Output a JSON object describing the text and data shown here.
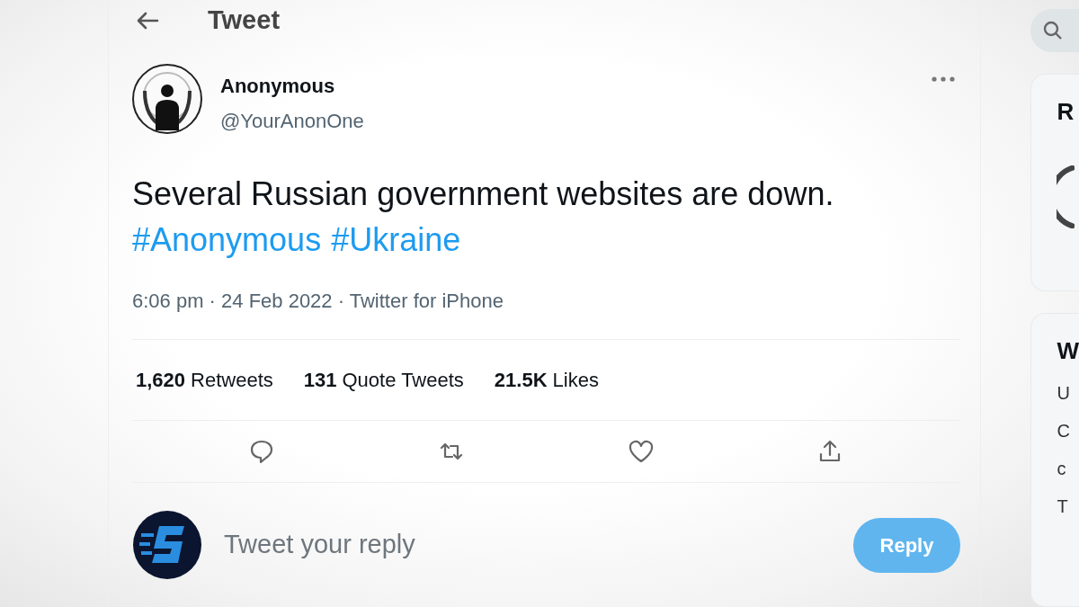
{
  "header": {
    "title": "Tweet"
  },
  "tweet": {
    "name": "Anonymous",
    "handle": "@YourAnonOne",
    "text": "Several Russian government websites are down.",
    "hashtags": [
      "#Anonymous",
      "#Ukraine"
    ],
    "meta": "6:06 pm · 24 Feb 2022 · Twitter for iPhone",
    "stats": [
      {
        "count": "1,620",
        "label": "Retweets"
      },
      {
        "count": "131",
        "label": "Quote Tweets"
      },
      {
        "count": "21.5K",
        "label": "Likes"
      }
    ],
    "actions": [
      {
        "kind": "reply"
      },
      {
        "kind": "retweet"
      },
      {
        "kind": "like"
      },
      {
        "kind": "share"
      }
    ]
  },
  "reply_box": {
    "placeholder": "Tweet your reply",
    "button": "Reply",
    "disabled": true
  },
  "sidebar": {
    "cards": [
      {
        "heading": "R"
      },
      {
        "heading": "W",
        "lines": [
          "U",
          "C",
          "c",
          "T"
        ]
      }
    ]
  }
}
